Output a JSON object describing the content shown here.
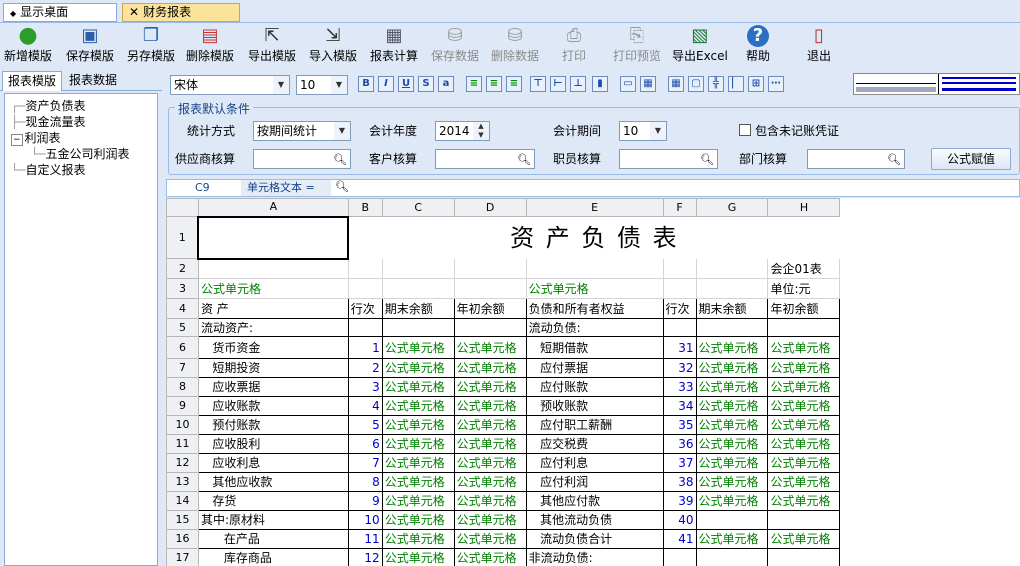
{
  "tabs": [
    {
      "label": "显示桌面",
      "icon": "diamond-icon"
    },
    {
      "label": "财务报表",
      "icon": "close-icon"
    }
  ],
  "toolbar": [
    {
      "label": "新增模版",
      "icon": "add-icon",
      "enabled": true
    },
    {
      "label": "保存模版",
      "icon": "save-icon",
      "enabled": true
    },
    {
      "label": "另存模版",
      "icon": "save-as-icon",
      "enabled": true
    },
    {
      "label": "删除模版",
      "icon": "delete-icon",
      "enabled": true
    },
    {
      "label": "导出模版",
      "icon": "export-icon",
      "enabled": true
    },
    {
      "label": "导入模版",
      "icon": "import-icon",
      "enabled": true
    },
    {
      "label": "报表计算",
      "icon": "calculator-icon",
      "enabled": true
    },
    {
      "label": "保存数据",
      "icon": "database-save-icon",
      "enabled": false
    },
    {
      "label": "删除数据",
      "icon": "database-delete-icon",
      "enabled": false
    },
    {
      "label": "打印",
      "icon": "print-icon",
      "enabled": false
    },
    {
      "label": "打印预览",
      "icon": "print-preview-icon",
      "enabled": false
    },
    {
      "label": "导出Excel",
      "icon": "excel-icon",
      "enabled": true
    },
    {
      "label": "帮助",
      "icon": "help-icon",
      "enabled": true
    },
    {
      "label": "退出",
      "icon": "exit-icon",
      "enabled": true
    }
  ],
  "left_tabs": [
    "报表模版",
    "报表数据"
  ],
  "tree": [
    {
      "label": "资产负债表",
      "level": 0
    },
    {
      "label": "现金流量表",
      "level": 0
    },
    {
      "label": "利润表",
      "level": 0,
      "expanded": true
    },
    {
      "label": "五金公司利润表",
      "level": 1
    },
    {
      "label": "自定义报表",
      "level": 0
    }
  ],
  "format": {
    "font": "宋体",
    "size": "10"
  },
  "conditions": {
    "legend": "报表默认条件",
    "stat_method_label": "统计方式",
    "stat_method": "按期间统计",
    "year_label": "会计年度",
    "year": "2014",
    "period_label": "会计期间",
    "period": "10",
    "include_unposted": "包含未记账凭证",
    "supplier_label": "供应商核算",
    "customer_label": "客户核算",
    "employee_label": "职员核算",
    "dept_label": "部门核算",
    "formula_btn": "公式赋值"
  },
  "formula_bar": {
    "cell": "C9",
    "label": "单元格文本 ="
  },
  "sheet": {
    "cols": [
      "A",
      "B",
      "C",
      "D",
      "E",
      "F",
      "G",
      "H"
    ],
    "title": "资 产 负 债 表",
    "r2_h": "会企01表",
    "r3_a": "公式单元格",
    "r3_e": "公式单元格",
    "r3_h": "单位:元",
    "header": [
      "资    产",
      "行次",
      "期末余额",
      "年初余额",
      "负债和所有者权益",
      "行次",
      "期末余额",
      "年初余额"
    ],
    "formula": "公式单元格",
    "rows": [
      {
        "n": "5",
        "a": "流动资产:",
        "b": "",
        "cd": false,
        "e": "流动负债:",
        "f": "",
        "gh": false
      },
      {
        "n": "6",
        "a": "   货币资金",
        "b": "1",
        "cd": true,
        "e": "   短期借款",
        "f": "31",
        "gh": true
      },
      {
        "n": "7",
        "a": "   短期投资",
        "b": "2",
        "cd": true,
        "e": "   应付票据",
        "f": "32",
        "gh": true
      },
      {
        "n": "8",
        "a": "   应收票据",
        "b": "3",
        "cd": true,
        "e": "   应付账款",
        "f": "33",
        "gh": true
      },
      {
        "n": "9",
        "a": "   应收账款",
        "b": "4",
        "cd": true,
        "e": "   预收账款",
        "f": "34",
        "gh": true
      },
      {
        "n": "10",
        "a": "   预付账款",
        "b": "5",
        "cd": true,
        "e": "   应付职工薪酬",
        "f": "35",
        "gh": true
      },
      {
        "n": "11",
        "a": "   应收股利",
        "b": "6",
        "cd": true,
        "e": "   应交税费",
        "f": "36",
        "gh": true
      },
      {
        "n": "12",
        "a": "   应收利息",
        "b": "7",
        "cd": true,
        "e": "   应付利息",
        "f": "37",
        "gh": true
      },
      {
        "n": "13",
        "a": "   其他应收款",
        "b": "8",
        "cd": true,
        "e": "   应付利润",
        "f": "38",
        "gh": true
      },
      {
        "n": "14",
        "a": "   存货",
        "b": "9",
        "cd": true,
        "e": "   其他应付款",
        "f": "39",
        "gh": true
      },
      {
        "n": "15",
        "a": "其中:原材料",
        "b": "10",
        "cd": true,
        "e": "   其他流动负债",
        "f": "40",
        "gh": false
      },
      {
        "n": "16",
        "a": "      在产品",
        "b": "11",
        "cd": true,
        "e": "   流动负债合计",
        "f": "41",
        "gh": true
      },
      {
        "n": "17",
        "a": "      库存商品",
        "b": "12",
        "cd": true,
        "e": "非流动负债:",
        "f": "",
        "gh": false
      }
    ]
  }
}
